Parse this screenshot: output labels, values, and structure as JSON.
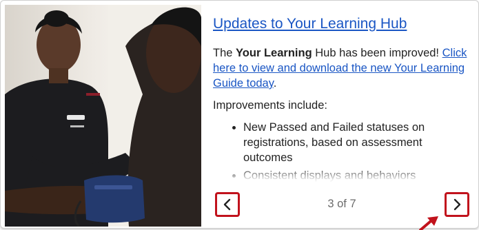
{
  "card": {
    "title": "Updates to Your Learning Hub",
    "intro_prefix": "The ",
    "intro_bold": "Your Learning",
    "intro_suffix": " Hub has been improved!",
    "link_text": "Click here to view and download the new Your Learning Guide today",
    "link_end": ".",
    "improvements_label": "Improvements include:",
    "bullets": [
      "New Passed and Failed statuses on registrations, based on assessment outcomes",
      "Consistent displays and behaviors"
    ]
  },
  "pagination": {
    "current": "3",
    "separator": " of ",
    "total": "7"
  },
  "icons": {
    "prev": "chevron-left-icon",
    "next": "chevron-right-icon",
    "annotation": "arrow-pointer-icon"
  },
  "colors": {
    "link": "#1a56c4",
    "highlight": "#c1121c"
  }
}
